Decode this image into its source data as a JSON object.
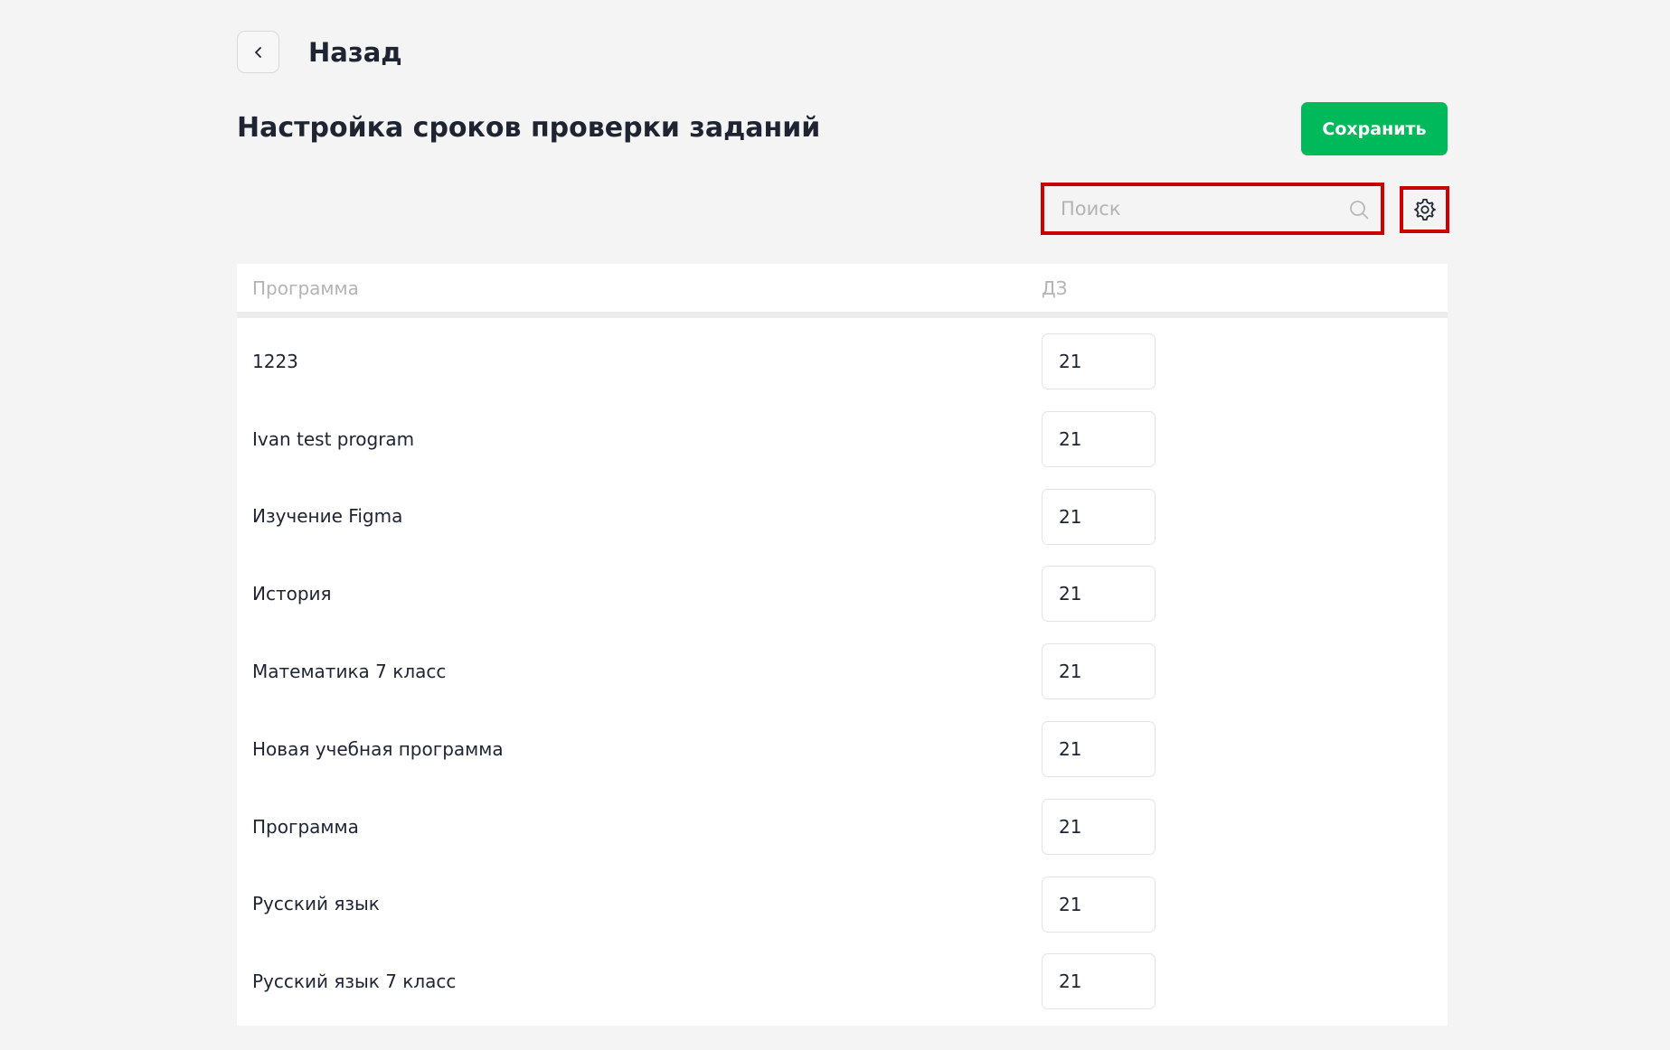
{
  "header": {
    "back_label": "Назад",
    "back_icon": "chevron-left-icon"
  },
  "page": {
    "title": "Настройка сроков проверки заданий",
    "save_label": "Сохранить"
  },
  "search": {
    "value": "",
    "placeholder": "Поиск",
    "icon": "search-icon"
  },
  "settings": {
    "icon": "gear-icon"
  },
  "table": {
    "columns": [
      "Программа",
      "ДЗ"
    ],
    "rows": [
      {
        "program": "1223",
        "hw_days": "21"
      },
      {
        "program": "Ivan test program",
        "hw_days": "21"
      },
      {
        "program": "Изучение Figma",
        "hw_days": "21"
      },
      {
        "program": "История",
        "hw_days": "21"
      },
      {
        "program": "Математика 7 класс",
        "hw_days": "21"
      },
      {
        "program": "Новая учебная программа",
        "hw_days": "21"
      },
      {
        "program": "Программа",
        "hw_days": "21"
      },
      {
        "program": "Русский язык",
        "hw_days": "21"
      },
      {
        "program": "Русский язык 7 класс",
        "hw_days": "21"
      }
    ]
  },
  "colors": {
    "accent": "#00b95a",
    "highlight": "#cc0000",
    "background": "#f4f4f4"
  }
}
